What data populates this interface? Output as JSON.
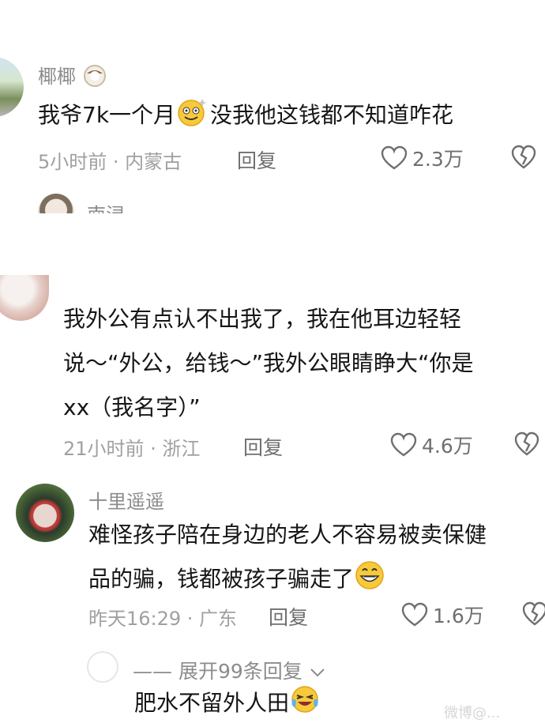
{
  "comments": [
    {
      "username": "椰椰",
      "username_emoji": "coconut-emoji",
      "text": "我爷7k一个月",
      "text_emoji": "dizzy-smiley-emoji",
      "text_after": "没我他这钱都不知道咋花",
      "time_location": "5小时前 · 内蒙古",
      "reply_label": "回复",
      "likes": "2.3万"
    },
    {
      "username_partial": "南浔",
      "lines": [
        "我外公有点认不出我了，我在他耳边轻轻",
        "说～“外公，给钱～”我外公眼睛睁大“你是",
        "xx（我名字）”"
      ],
      "time_location": "21小时前 · 浙江",
      "reply_label": "回复",
      "likes": "4.6万"
    },
    {
      "username": "十里遥遥",
      "line1": "难怪孩子陪在身边的老人不容易被卖保健",
      "line2": "品的骗，钱都被孩子骗走了",
      "line2_emoji": "grinning-emoji",
      "time_location": "昨天16:29 · 广东",
      "reply_label": "回复",
      "likes": "1.6万"
    }
  ],
  "expand_replies": "—— 展开99条回复",
  "sub_reply": {
    "text": "肥水不留外人田",
    "emoji": "laughing-crying-emoji"
  },
  "watermark": "微博@..."
}
